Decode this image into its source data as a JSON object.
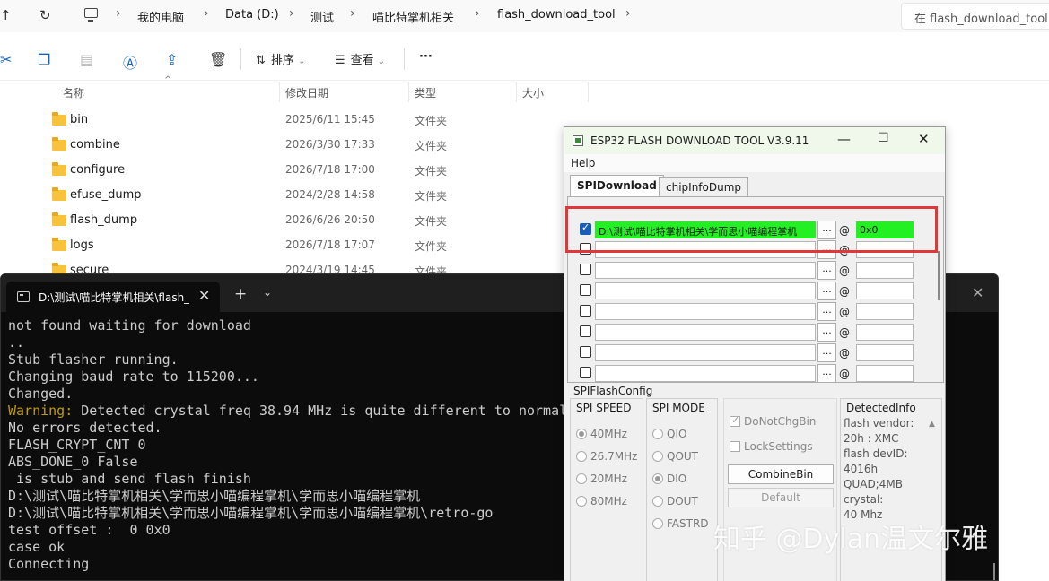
{
  "explorer": {
    "breadcrumb": [
      "我的电脑",
      "Data (D:)",
      "测试",
      "喵比特掌机相关",
      "flash_download_tool"
    ],
    "search_placeholder": "在 flash_download_tool 中搜索",
    "toolbar": {
      "sort_label": "排序",
      "view_label": "查看",
      "more_label": "···"
    },
    "columns": [
      "名称",
      "修改日期",
      "类型",
      "大小"
    ],
    "files": [
      {
        "name": "bin",
        "date": "2025/6/11 15:45",
        "type": "文件夹"
      },
      {
        "name": "combine",
        "date": "2026/3/30 17:33",
        "type": "文件夹"
      },
      {
        "name": "configure",
        "date": "2026/7/18 17:00",
        "type": "文件夹"
      },
      {
        "name": "efuse_dump",
        "date": "2024/2/28 14:58",
        "type": "文件夹"
      },
      {
        "name": "flash_dump",
        "date": "2026/6/26 20:50",
        "type": "文件夹"
      },
      {
        "name": "logs",
        "date": "2026/7/18 17:07",
        "type": "文件夹"
      },
      {
        "name": "secure",
        "date": "2024/3/19 14:45",
        "type": "文件夹"
      }
    ]
  },
  "terminal": {
    "tab_title": "D:\\测试\\喵比特掌机相关\\flash_",
    "lines": [
      "not found waiting for download",
      "..",
      "Stub flasher running.",
      "Changing baud rate to 115200...",
      "Changed.",
      "Warning: Detected crystal freq 38.94 MHz is quite different to normal",
      "No errors detected.",
      "FLASH_CRYPT_CNT 0",
      "ABS_DONE_0 False",
      "",
      " is stub and send flash finish",
      "D:\\测试\\喵比特掌机相关\\学而思小喵编程掌机\\学而思小喵编程掌机",
      "D:\\测试\\喵比特掌机相关\\学而思小喵编程掌机\\学而思小喵编程掌机\\retro-go",
      "test offset :  0 0x0",
      "case ok",
      "Connecting"
    ]
  },
  "esp_tool": {
    "title": "ESP32 FLASH DOWNLOAD TOOL V3.9.11",
    "menu_help": "Help",
    "tabs": [
      "SPIDownload",
      "chipInfoDump"
    ],
    "file_rows": [
      {
        "checked": true,
        "path": "D:\\测试\\喵比特掌机相关\\学而思小喵编程掌机",
        "addr": "0x0"
      },
      {
        "checked": false,
        "path": "",
        "addr": ""
      },
      {
        "checked": false,
        "path": "",
        "addr": ""
      },
      {
        "checked": false,
        "path": "",
        "addr": ""
      },
      {
        "checked": false,
        "path": "",
        "addr": ""
      },
      {
        "checked": false,
        "path": "",
        "addr": ""
      },
      {
        "checked": false,
        "path": "",
        "addr": ""
      },
      {
        "checked": false,
        "path": "",
        "addr": ""
      }
    ],
    "browse_label": "...",
    "at_label": "@",
    "spi_flash_config": "SPIFlashConfig",
    "spi_speed": {
      "title": "SPI SPEED",
      "options": [
        "40MHz",
        "26.7MHz",
        "20MHz",
        "80MHz"
      ],
      "selected": "40MHz"
    },
    "spi_mode": {
      "title": "SPI MODE",
      "options": [
        "QIO",
        "QOUT",
        "DIO",
        "DOUT",
        "FASTRD"
      ],
      "selected": "DIO"
    },
    "do_not_chg_bin": "DoNotChgBin",
    "lock_settings": "LockSettings",
    "combine_bin": "CombineBin",
    "default_btn": "Default",
    "detected_info": {
      "title": "DetectedInfo",
      "text": "flash vendor:\n20h : XMC\nflash devID:\n4016h\nQUAD;4MB\ncrystal:\n40 Mhz"
    }
  },
  "watermark": "知乎 @Dylan温文尔雅"
}
